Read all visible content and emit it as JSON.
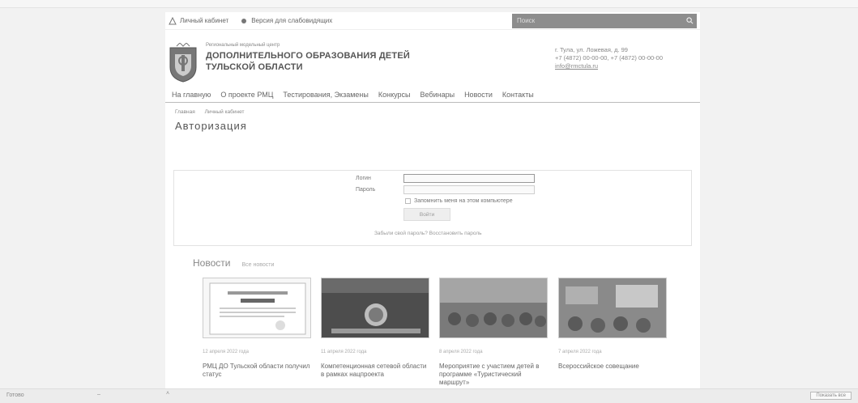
{
  "topbar": {
    "items": [
      "Личный кабинет",
      "Версия для слабовидящих"
    ],
    "search_placeholder": "Поиск"
  },
  "brand": {
    "small": "Региональный модельный центр",
    "line1": "ДОПОЛНИТЕЛЬНОГО ОБРАЗОВАНИЯ ДЕТЕЙ",
    "line2": "ТУЛЬСКОЙ ОБЛАСТИ"
  },
  "contacts": {
    "address": "г. Тула, ул. Ложевая, д. 99",
    "phone": "+7 (4872) 00-00-00, +7 (4872) 00-00-00",
    "email": "info@rmctula.ru"
  },
  "nav": [
    "На главную",
    "О проекте РМЦ",
    "Тестирования, Экзамены",
    "Конкурсы",
    "Вебинары",
    "Новости",
    "Контакты"
  ],
  "breadcrumbs": [
    "Главная",
    "Личный кабинет"
  ],
  "page_title": "Авторизация",
  "login": {
    "username_label": "Логин",
    "password_label": "Пароль",
    "remember_label": "Запомнить меня на этом компьютере",
    "submit_label": "Войти",
    "forgot_link": "Забыли свой пароль? Восстановить пароль"
  },
  "news": {
    "heading": "Новости",
    "all_link": "Все новости",
    "cards": [
      {
        "date": "12 апреля 2022 года",
        "text": "РМЦ ДО Тульской области получил статус",
        "icon": "certificate-image"
      },
      {
        "date": "11 апреля 2022 года",
        "text": "Компетенционная сетевой области в рамках нацпроекта",
        "icon": "event-banner-image"
      },
      {
        "date": "8 апреля 2022 года",
        "text": "Мероприятие с участием детей в программе «Туристический маршрут»",
        "icon": "outdoor-group-image"
      },
      {
        "date": "7 апреля 2022 года",
        "text": "Всероссийское совещание",
        "icon": "meeting-image"
      }
    ]
  },
  "statusbar": {
    "left": "Готово",
    "button": "Показать все"
  }
}
